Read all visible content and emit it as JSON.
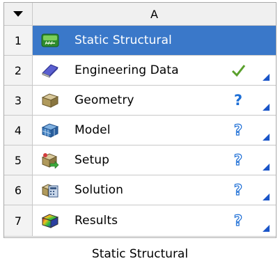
{
  "header": {
    "column_label": "A",
    "dropdown_icon": "triangle-down-icon"
  },
  "rows": [
    {
      "num": "1",
      "label": "Static Structural",
      "icon": "static-structural-icon",
      "status": ""
    },
    {
      "num": "2",
      "label": "Engineering Data",
      "icon": "engineering-data-icon",
      "status": "up-to-date-check"
    },
    {
      "num": "3",
      "label": "Geometry",
      "icon": "geometry-icon",
      "status": "unfulfilled-question"
    },
    {
      "num": "4",
      "label": "Model",
      "icon": "model-icon",
      "status": "refresh-required-question"
    },
    {
      "num": "5",
      "label": "Setup",
      "icon": "setup-icon",
      "status": "refresh-required-question"
    },
    {
      "num": "6",
      "label": "Solution",
      "icon": "solution-icon",
      "status": "refresh-required-question"
    },
    {
      "num": "7",
      "label": "Results",
      "icon": "results-icon",
      "status": "refresh-required-question"
    }
  ],
  "system_name": "Static Structural",
  "colors": {
    "selected_row": "#3a78c9",
    "check": "#5aa02c",
    "question": "#1e6fd6",
    "corner_triangle": "#1a55c8"
  }
}
